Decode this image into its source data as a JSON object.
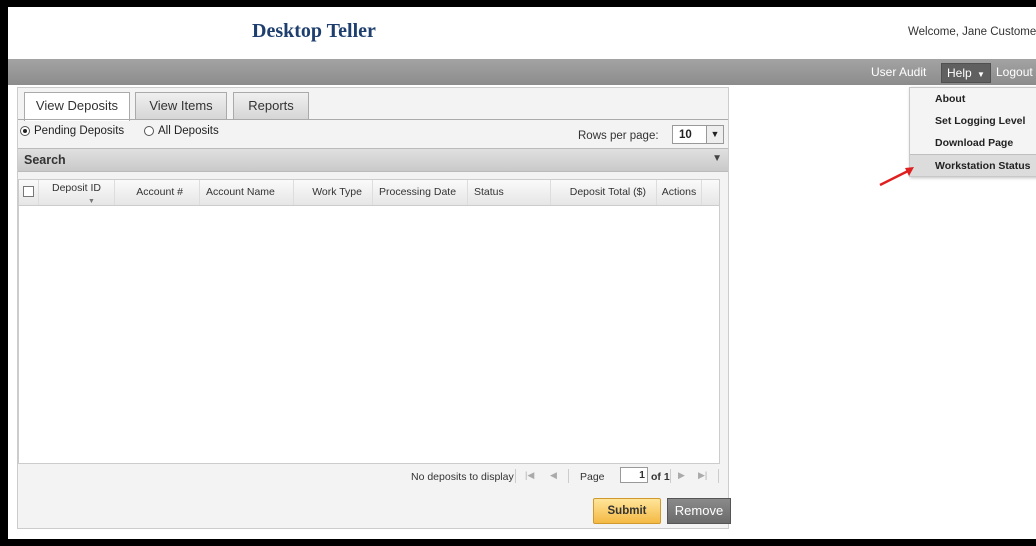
{
  "header": {
    "app_title": "Desktop Teller",
    "welcome": "Welcome, Jane Customer"
  },
  "menubar": {
    "user_audit": "User Audit",
    "help": "Help",
    "logout": "Logout"
  },
  "help_menu": {
    "items": [
      "About",
      "Set Logging Level",
      "Download Page",
      "Workstation Status"
    ],
    "highlighted": "Workstation Status"
  },
  "annotation": {
    "arrow_color": "#e02020"
  },
  "tabs": [
    "View Deposits",
    "View Items",
    "Reports"
  ],
  "active_tab": "View Deposits",
  "filter": {
    "pending": "Pending Deposits",
    "all": "All Deposits",
    "selected": "Pending Deposits"
  },
  "rows_per_page": {
    "label": "Rows per page:",
    "value": "10"
  },
  "search": {
    "title": "Search"
  },
  "grid": {
    "columns": [
      "Deposit ID",
      "Account #",
      "Account Name",
      "Work Type",
      "Processing Date",
      "Status",
      "Deposit Total ($)",
      "Actions"
    ]
  },
  "pager": {
    "empty_message": "No deposits to display",
    "page_label": "Page",
    "page_value": "1",
    "of_label": "of 1"
  },
  "buttons": {
    "submit": "Submit",
    "remove": "Remove"
  },
  "colors": {
    "title_blue": "#1e3f6e",
    "menubar_gray": "#999999",
    "submit_orange": "#f4b944"
  }
}
